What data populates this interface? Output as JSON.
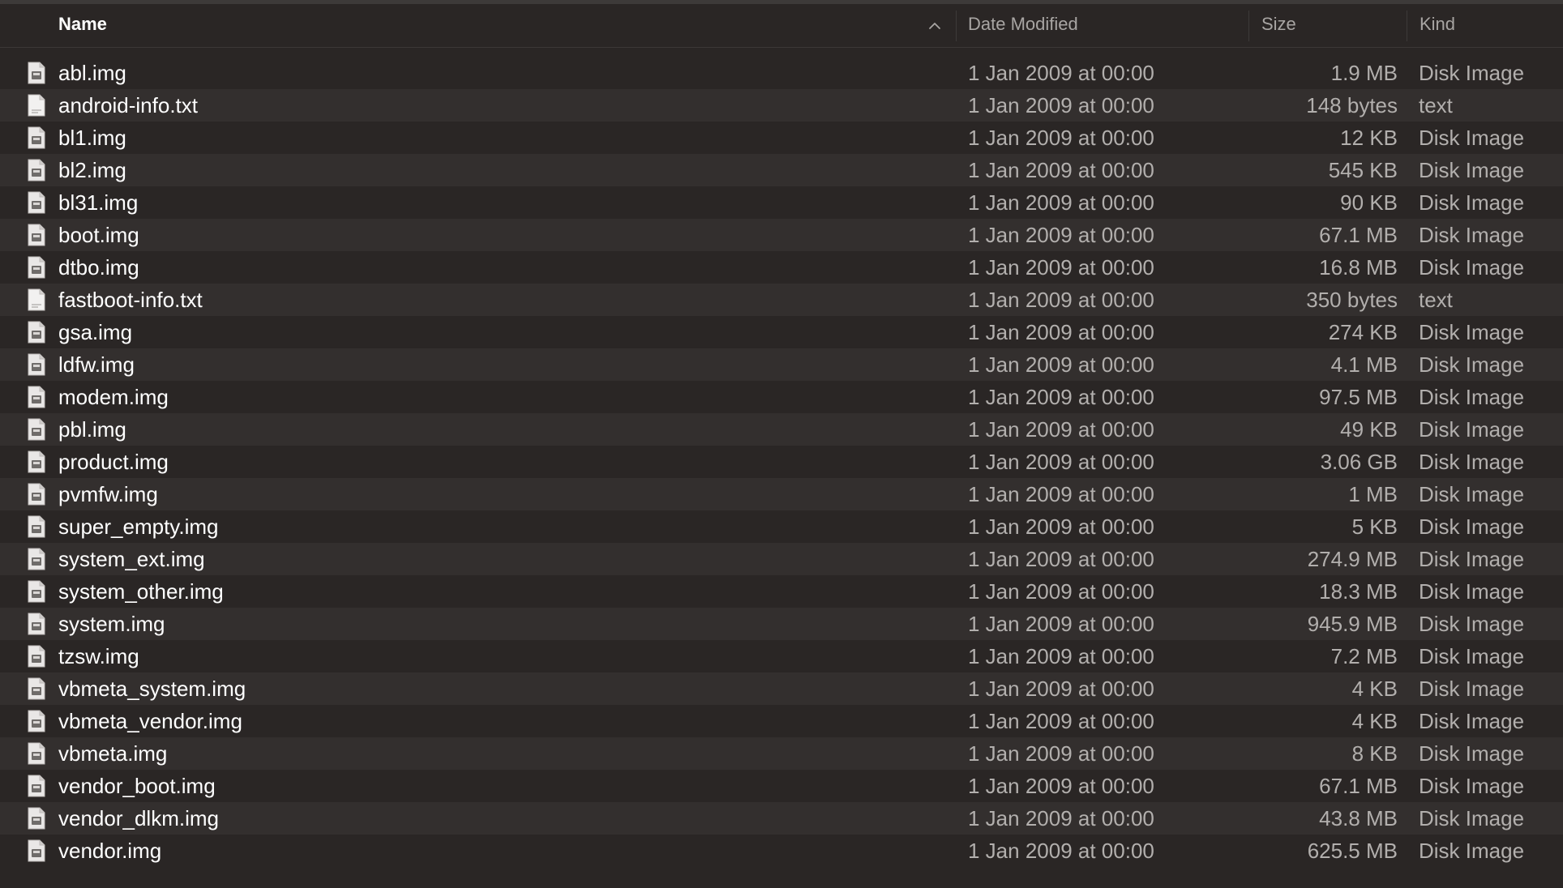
{
  "columns": {
    "name": "Name",
    "date_modified": "Date Modified",
    "size": "Size",
    "kind": "Kind"
  },
  "sort": {
    "column": "Name",
    "direction": "ascending",
    "icon": "chevron-up-icon"
  },
  "colors": {
    "background": "#2a2625",
    "row_alt": "#332f2e",
    "text_primary": "#ffffff",
    "text_secondary": "#b2afad"
  },
  "files": [
    {
      "name": "abl.img",
      "date": "1 Jan 2009 at 00:00",
      "size": "1.9 MB",
      "kind": "Disk Image",
      "icon": "disk-image-file-icon"
    },
    {
      "name": "android-info.txt",
      "date": "1 Jan 2009 at 00:00",
      "size": "148 bytes",
      "kind": "text",
      "icon": "text-file-icon"
    },
    {
      "name": "bl1.img",
      "date": "1 Jan 2009 at 00:00",
      "size": "12 KB",
      "kind": "Disk Image",
      "icon": "disk-image-file-icon"
    },
    {
      "name": "bl2.img",
      "date": "1 Jan 2009 at 00:00",
      "size": "545 KB",
      "kind": "Disk Image",
      "icon": "disk-image-file-icon"
    },
    {
      "name": "bl31.img",
      "date": "1 Jan 2009 at 00:00",
      "size": "90 KB",
      "kind": "Disk Image",
      "icon": "disk-image-file-icon"
    },
    {
      "name": "boot.img",
      "date": "1 Jan 2009 at 00:00",
      "size": "67.1 MB",
      "kind": "Disk Image",
      "icon": "disk-image-file-icon"
    },
    {
      "name": "dtbo.img",
      "date": "1 Jan 2009 at 00:00",
      "size": "16.8 MB",
      "kind": "Disk Image",
      "icon": "disk-image-file-icon"
    },
    {
      "name": "fastboot-info.txt",
      "date": "1 Jan 2009 at 00:00",
      "size": "350 bytes",
      "kind": "text",
      "icon": "text-file-icon"
    },
    {
      "name": "gsa.img",
      "date": "1 Jan 2009 at 00:00",
      "size": "274 KB",
      "kind": "Disk Image",
      "icon": "disk-image-file-icon"
    },
    {
      "name": "ldfw.img",
      "date": "1 Jan 2009 at 00:00",
      "size": "4.1 MB",
      "kind": "Disk Image",
      "icon": "disk-image-file-icon"
    },
    {
      "name": "modem.img",
      "date": "1 Jan 2009 at 00:00",
      "size": "97.5 MB",
      "kind": "Disk Image",
      "icon": "disk-image-file-icon"
    },
    {
      "name": "pbl.img",
      "date": "1 Jan 2009 at 00:00",
      "size": "49 KB",
      "kind": "Disk Image",
      "icon": "disk-image-file-icon"
    },
    {
      "name": "product.img",
      "date": "1 Jan 2009 at 00:00",
      "size": "3.06 GB",
      "kind": "Disk Image",
      "icon": "disk-image-file-icon"
    },
    {
      "name": "pvmfw.img",
      "date": "1 Jan 2009 at 00:00",
      "size": "1 MB",
      "kind": "Disk Image",
      "icon": "disk-image-file-icon"
    },
    {
      "name": "super_empty.img",
      "date": "1 Jan 2009 at 00:00",
      "size": "5 KB",
      "kind": "Disk Image",
      "icon": "disk-image-file-icon"
    },
    {
      "name": "system_ext.img",
      "date": "1 Jan 2009 at 00:00",
      "size": "274.9 MB",
      "kind": "Disk Image",
      "icon": "disk-image-file-icon"
    },
    {
      "name": "system_other.img",
      "date": "1 Jan 2009 at 00:00",
      "size": "18.3 MB",
      "kind": "Disk Image",
      "icon": "disk-image-file-icon"
    },
    {
      "name": "system.img",
      "date": "1 Jan 2009 at 00:00",
      "size": "945.9 MB",
      "kind": "Disk Image",
      "icon": "disk-image-file-icon"
    },
    {
      "name": "tzsw.img",
      "date": "1 Jan 2009 at 00:00",
      "size": "7.2 MB",
      "kind": "Disk Image",
      "icon": "disk-image-file-icon"
    },
    {
      "name": "vbmeta_system.img",
      "date": "1 Jan 2009 at 00:00",
      "size": "4 KB",
      "kind": "Disk Image",
      "icon": "disk-image-file-icon"
    },
    {
      "name": "vbmeta_vendor.img",
      "date": "1 Jan 2009 at 00:00",
      "size": "4 KB",
      "kind": "Disk Image",
      "icon": "disk-image-file-icon"
    },
    {
      "name": "vbmeta.img",
      "date": "1 Jan 2009 at 00:00",
      "size": "8 KB",
      "kind": "Disk Image",
      "icon": "disk-image-file-icon"
    },
    {
      "name": "vendor_boot.img",
      "date": "1 Jan 2009 at 00:00",
      "size": "67.1 MB",
      "kind": "Disk Image",
      "icon": "disk-image-file-icon"
    },
    {
      "name": "vendor_dlkm.img",
      "date": "1 Jan 2009 at 00:00",
      "size": "43.8 MB",
      "kind": "Disk Image",
      "icon": "disk-image-file-icon"
    },
    {
      "name": "vendor.img",
      "date": "1 Jan 2009 at 00:00",
      "size": "625.5 MB",
      "kind": "Disk Image",
      "icon": "disk-image-file-icon"
    }
  ]
}
